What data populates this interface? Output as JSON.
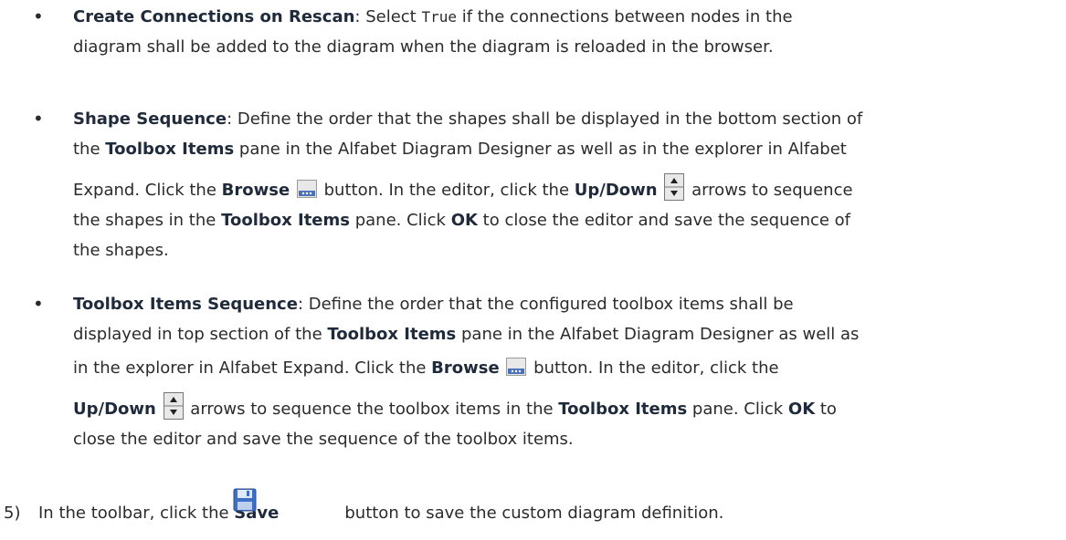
{
  "bullets": {
    "b1": {
      "term": "Create Connections on Rescan",
      "t1": ": Select ",
      "code": "True",
      "t2": " if the connections between nodes in the",
      "t3": "diagram shall be added to the diagram when the diagram is reloaded in the browser."
    },
    "b2": {
      "term": "Shape Sequence",
      "t1": ": Define the order that the shapes shall be displayed in the bottom section of",
      "t2": "the ",
      "b1": "Toolbox Items",
      "t3": " pane in the Alfabet Diagram Designer as well as in the explorer in Alfabet",
      "t4": "Expand. Click the ",
      "b2": "Browse",
      "t5": " button. In the editor, click the ",
      "b3": "Up/Down",
      "t6": " arrows to sequence",
      "t7": "the shapes in the ",
      "b4": "Toolbox Items",
      "t8": " pane. Click ",
      "b5": "OK",
      "t9": " to close the editor and save the sequence of",
      "t10": "the shapes."
    },
    "b3": {
      "term": "Toolbox Items Sequence",
      "t1": ": Define the order that the configured toolbox items shall be",
      "t2": "displayed in top section of the ",
      "b1": "Toolbox Items",
      "t3": " pane in the Alfabet Diagram Designer as well as",
      "t4": "in the explorer in Alfabet Expand. Click the ",
      "b2": "Browse",
      "t5": " button. In the editor, click the",
      "b3": "Up/Down",
      "t6": " arrows to sequence the toolbox items in the ",
      "b4": "Toolbox Items",
      "t7": " pane. Click ",
      "b5": "OK",
      "t8": " to",
      "t9": "close the editor and save the sequence of the toolbox items."
    }
  },
  "bullet_char": "•",
  "step": {
    "num": "5)",
    "t1": "In the toolbar, click the ",
    "b1": "Save",
    "t2": "button to save the custom diagram definition."
  }
}
